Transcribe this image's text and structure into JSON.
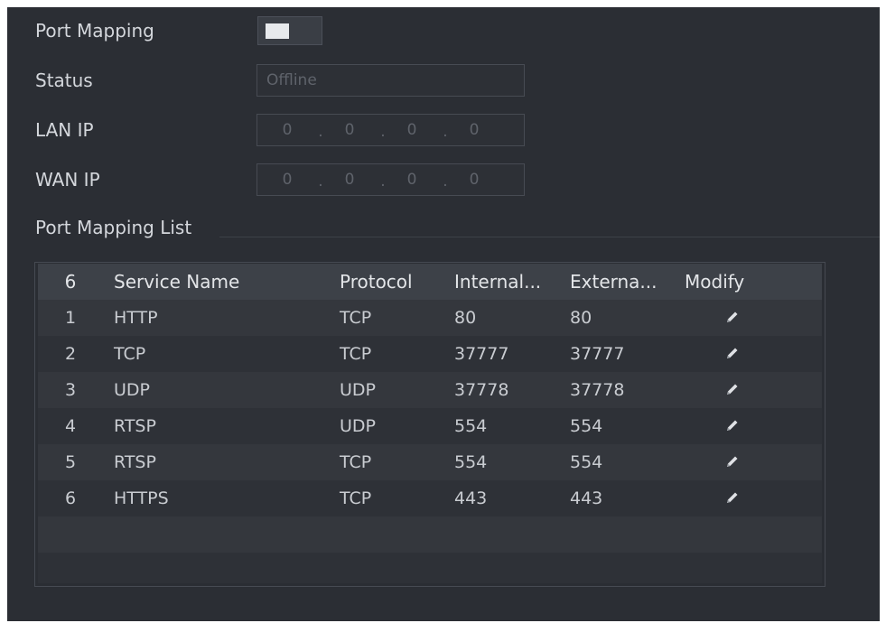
{
  "form": {
    "port_mapping_label": "Port Mapping",
    "status_label": "Status",
    "status_value": "Offline",
    "lan_ip_label": "LAN IP",
    "lan_ip": [
      "0",
      "0",
      "0",
      "0"
    ],
    "wan_ip_label": "WAN IP",
    "wan_ip": [
      "0",
      "0",
      "0",
      "0"
    ]
  },
  "list": {
    "title": "Port Mapping List",
    "header": {
      "count": "6",
      "service_name": "Service Name",
      "protocol": "Protocol",
      "internal": "Internal...",
      "external": "Externa...",
      "modify": "Modify"
    },
    "rows": [
      {
        "num": "1",
        "service": "HTTP",
        "protocol": "TCP",
        "internal": "80",
        "external": "80"
      },
      {
        "num": "2",
        "service": "TCP",
        "protocol": "TCP",
        "internal": "37777",
        "external": "37777"
      },
      {
        "num": "3",
        "service": "UDP",
        "protocol": "UDP",
        "internal": "37778",
        "external": "37778"
      },
      {
        "num": "4",
        "service": "RTSP",
        "protocol": "UDP",
        "internal": "554",
        "external": "554"
      },
      {
        "num": "5",
        "service": "RTSP",
        "protocol": "TCP",
        "internal": "554",
        "external": "554"
      },
      {
        "num": "6",
        "service": "HTTPS",
        "protocol": "TCP",
        "internal": "443",
        "external": "443"
      }
    ],
    "edit_icon": "pencil-icon"
  },
  "colors": {
    "panel_bg": "#2b2e34",
    "header_bg": "#3d4148",
    "row_odd": "#34373d",
    "row_even": "#2e3137",
    "text": "#c9ccd1"
  }
}
